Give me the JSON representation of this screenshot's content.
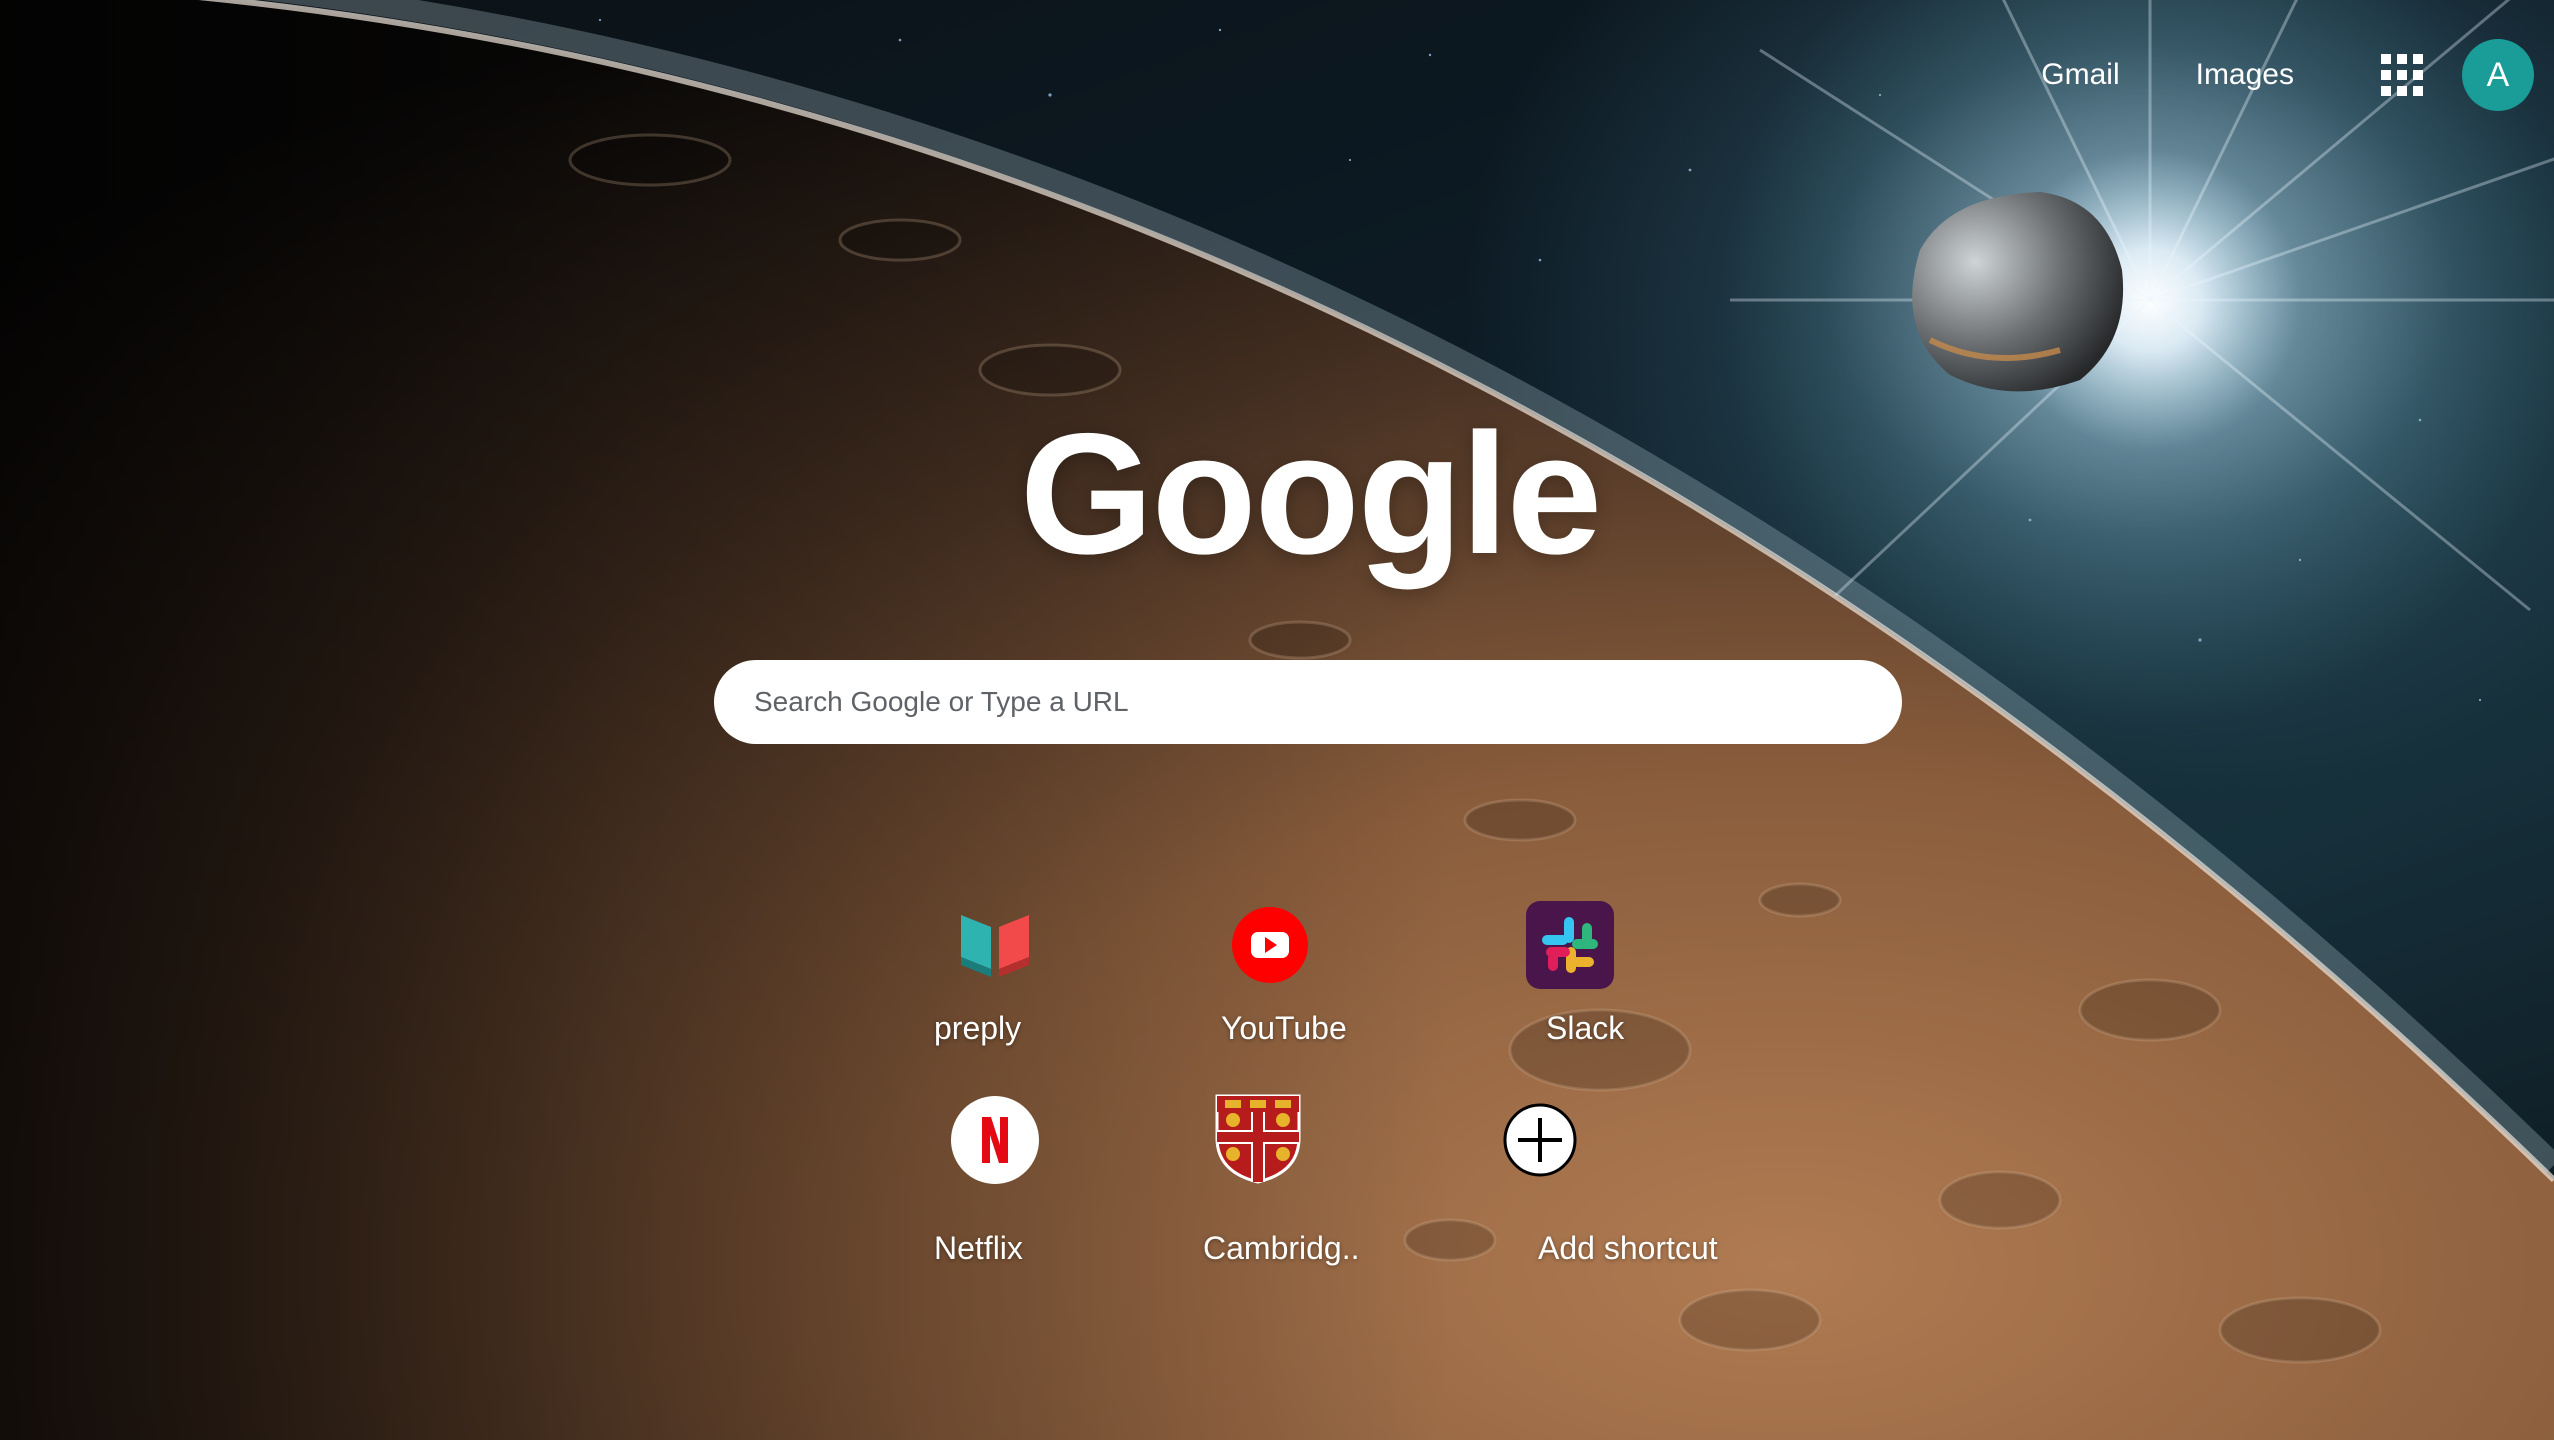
{
  "header": {
    "gmail_label": "Gmail",
    "images_label": "Images",
    "apps_icon": "apps-grid-icon",
    "avatar_letter": "A",
    "avatar_color": "#1a9c98"
  },
  "logo_text": "Google",
  "search": {
    "placeholder": "Search Google or Type a URL",
    "value": ""
  },
  "shortcuts": [
    {
      "label": "preply",
      "icon": "preply-logo-icon"
    },
    {
      "label": "YouTube",
      "icon": "youtube-logo-icon"
    },
    {
      "label": "Slack",
      "icon": "slack-logo-icon"
    },
    {
      "label": "Netflix",
      "icon": "netflix-logo-icon"
    },
    {
      "label": "Cambridg..",
      "icon": "cambridge-crest-icon"
    },
    {
      "label": "Add shortcut",
      "icon": "add-icon"
    }
  ],
  "colors": {
    "youtube_red": "#ff0000",
    "slack_bg": "#4a154b",
    "netflix_red": "#e50914",
    "preply_teal": "#2fb3b0",
    "preply_red": "#f24a4a"
  }
}
